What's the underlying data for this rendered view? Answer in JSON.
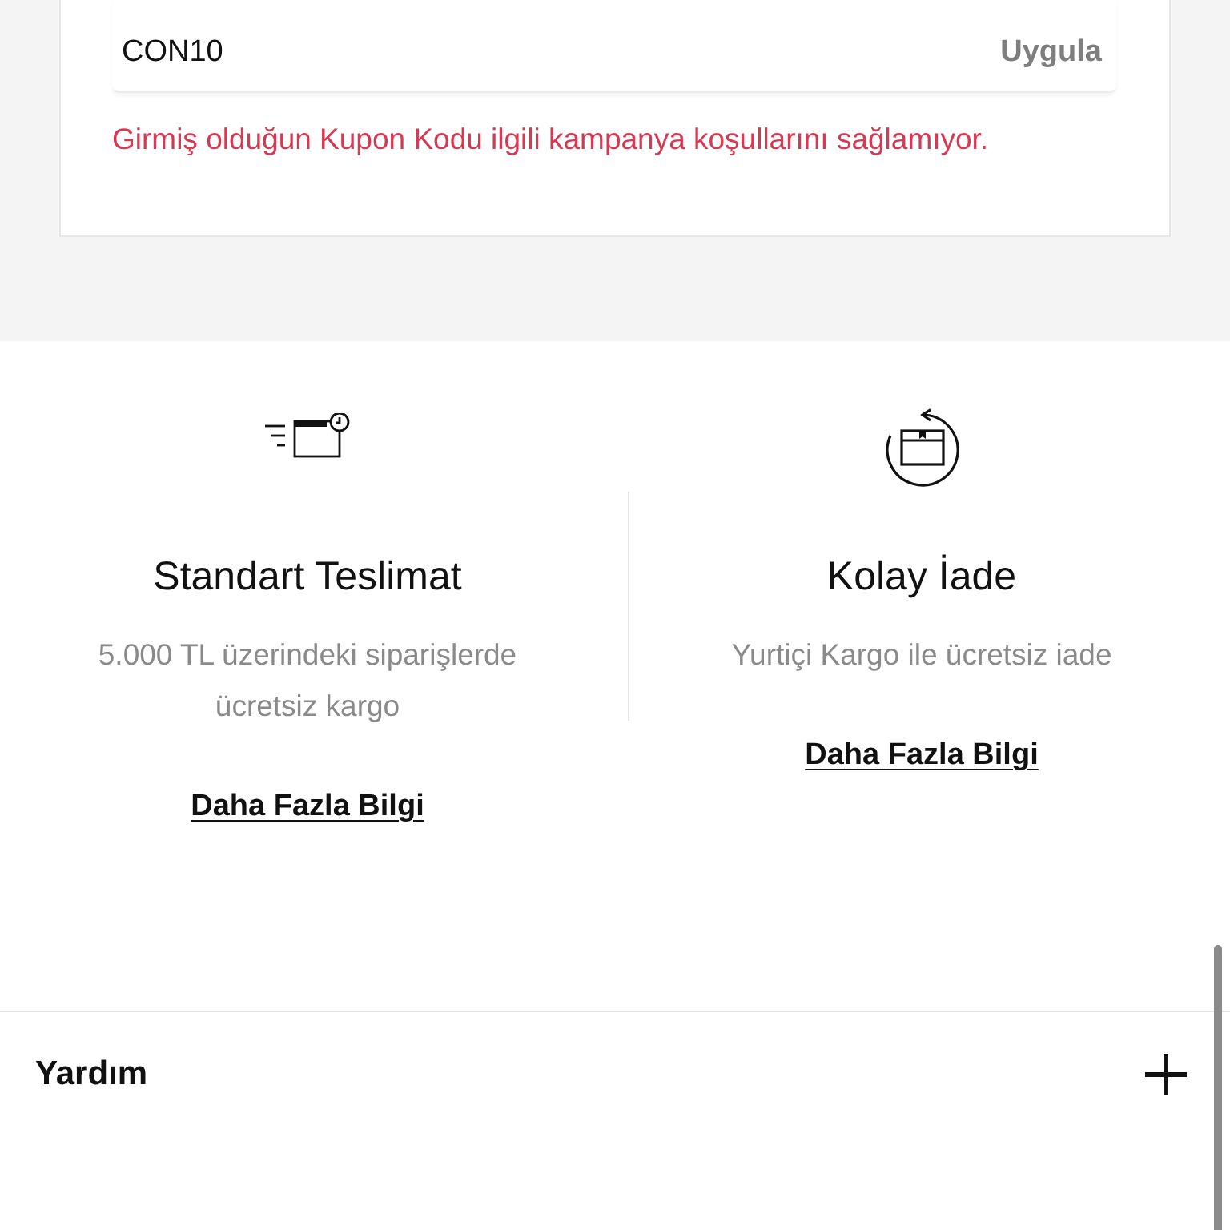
{
  "coupon": {
    "value": "CON10",
    "apply_label": "Uygula",
    "error": "Girmiş olduğun Kupon Kodu ilgili kampanya koşullarını sağlamıyor."
  },
  "features": [
    {
      "kind": "delivery",
      "title": "Standart Teslimat",
      "description": "5.000 TL üzerindeki siparişlerde ücretsiz kargo",
      "link": "Daha Fazla Bilgi"
    },
    {
      "kind": "return",
      "title": "Kolay İade",
      "description": "Yurtiçi Kargo ile ücretsiz iade",
      "link": "Daha Fazla Bilgi"
    }
  ],
  "accordion": [
    {
      "title": "Yardım",
      "expanded": false
    }
  ]
}
